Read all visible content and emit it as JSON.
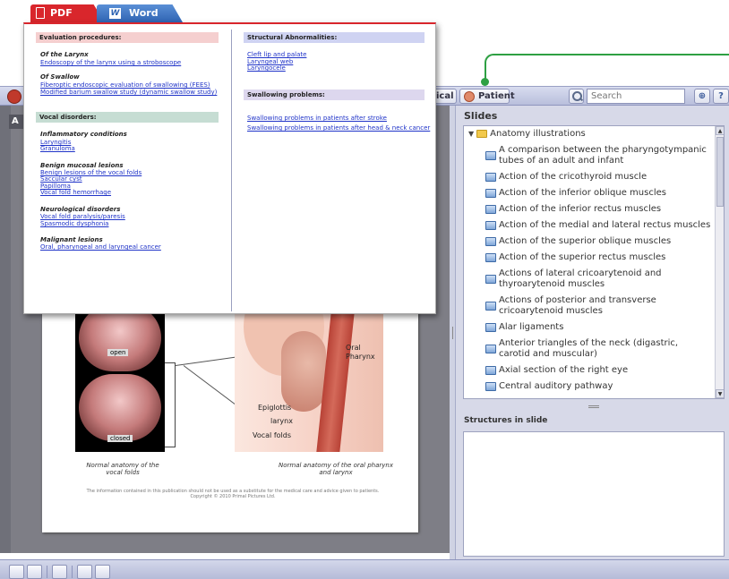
{
  "export_tabs": {
    "pdf": "PDF",
    "word": "Word"
  },
  "toolbar": {
    "partial_label": "ical",
    "patient_label": "Patient",
    "search_placeholder": "Search"
  },
  "doc_tab": "A",
  "illustration": {
    "open_label": "open",
    "closed_label": "closed",
    "oral_pharynx": "Oral\nPharynx",
    "epiglottis": "Epiglottis",
    "larynx": "larynx",
    "vocal_folds": "Vocal folds",
    "caption_left": "Normal anatomy of the\nvocal folds",
    "caption_right": "Normal anatomy of the oral pharynx\nand larynx",
    "disclaimer": "The information contained in this publication should not be used as a substitute for the medical care and advice given to patients.\nCopyright © 2010 Primal Pictures Ltd."
  },
  "slides_panel": {
    "title": "Slides",
    "root": "Anatomy illustrations",
    "items": [
      "A comparison between the pharyngotympanic tubes of an adult and infant",
      "Action of the cricothyroid muscle",
      "Action of the inferior oblique muscles",
      "Action of the inferior rectus muscles",
      "Action of the medial and lateral rectus muscles",
      "Action of the superior oblique muscles",
      "Action of the superior rectus muscles",
      "Actions of lateral cricoarytenoid and thyroarytenoid muscles",
      "Actions of posterior and transverse cricoarytenoid muscles",
      "Alar ligaments",
      "Anterior triangles of the neck (digastric, carotid and muscular)",
      "Axial section of the right eye",
      "Central auditory pathway"
    ]
  },
  "structures_panel": {
    "title": "Structures in slide"
  },
  "popup": {
    "evaluation": {
      "header": "Evaluation procedures:",
      "larynx_sub": "Of the Larynx",
      "larynx_link": "Endoscopy of the larynx using a stroboscope",
      "swallow_sub": "Of Swallow",
      "swallow_links": [
        "Fiberoptic endoscopic evaluation of swallowing (FEES)",
        "Modified barium swallow study (dynamic swallow study)"
      ]
    },
    "vocal": {
      "header": "Vocal disorders:",
      "inflammatory_sub": "Inflammatory conditions",
      "inflammatory_links": [
        "Laryngitis",
        "Granuloma"
      ],
      "benign_sub": "Benign mucosal lesions",
      "benign_links": [
        "Benign lesions of the vocal folds",
        "Saccular cyst",
        "Papilloma",
        "Vocal fold hemorrhage"
      ],
      "neuro_sub": "Neurological disorders",
      "neuro_links": [
        "Vocal fold paralysis/paresis",
        "Spasmodic dysphonia"
      ],
      "malignant_sub": "Malignant lesions",
      "malignant_links": [
        "Oral, pharyngeal and laryngeal cancer"
      ]
    },
    "structural": {
      "header": "Structural Abnormalities:",
      "links": [
        "Cleft lip and palate",
        "Laryngeal web",
        "Laryngocele"
      ]
    },
    "swallowing": {
      "header": "Swallowing problems:",
      "links": [
        "Swallowing problems in patients after stroke",
        "Swallowing problems in patients after head & neck cancer"
      ]
    }
  },
  "colors": {
    "pdf_red": "#d9262c",
    "word_blue": "#2f64b3",
    "link_blue": "#1f33c8",
    "callout_green": "#2ea043"
  }
}
